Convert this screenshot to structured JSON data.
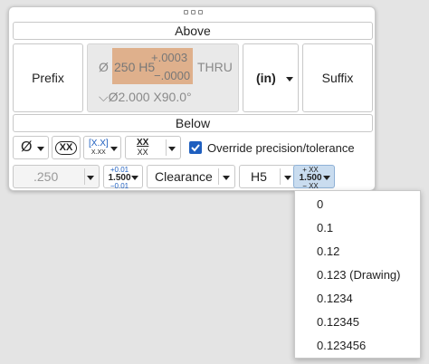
{
  "above": {
    "header": "Above",
    "prefix_label": "Prefix",
    "suffix_label": "Suffix",
    "units_value": "(in)"
  },
  "preview": {
    "diameter_symbol": "Ø",
    "size_text": "250 H5",
    "tol_upper": "+.0003",
    "tol_lower": "−.0000",
    "thru_text": "THRU",
    "depth_line": "⌵Ø2.000 X90.0°"
  },
  "below": {
    "header": "Below",
    "symbol_value": "Ø",
    "basic_label": "XX",
    "reference_label": "[X.X]",
    "reference_sub": "X.XX",
    "fraction_top": "XX",
    "fraction_bottom": "XX",
    "override_label": "Override precision/tolerance",
    "override_checked": true
  },
  "precision_row": {
    "value": ".250",
    "tol_upper": "+0.01",
    "tol_value": "1.500",
    "tol_lower": "−0.01",
    "fit_type": "Clearance",
    "fit_class": "H5",
    "fit_tol_upper": "+ XX",
    "fit_tol_value": "1.500",
    "fit_tol_lower": "− XX"
  },
  "precision_menu": {
    "options": [
      "0",
      "0.1",
      "0.12",
      "0.123 (Drawing)",
      "0.1234",
      "0.12345",
      "0.123456"
    ]
  },
  "colors": {
    "highlight": "#dfb08c",
    "checkbox": "#1f5fbf",
    "active_button": "#c9dcef"
  }
}
